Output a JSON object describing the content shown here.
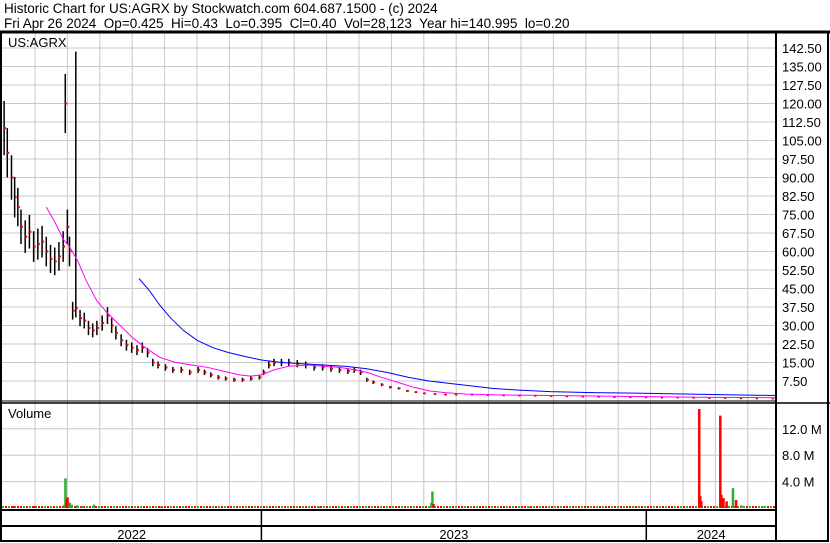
{
  "header": {
    "title": "Historic Chart for US:AGRX by Stockwatch.com 604.687.1500 - (c) 2024",
    "quote": "Fri Apr 26 2024  Op=0.425  Hi=0.43  Lo=0.395  Cl=0.40  Vol=28,123  Year hi=140.995  lo=0.20"
  },
  "colors": {
    "price_bar": "#000000",
    "close_tick": "#ff0000",
    "ma_short": "#ff00ff",
    "ma_long": "#0000ff",
    "vol_up": "#33aa33",
    "vol_down": "#ff0000",
    "grid": "#c8c8c8"
  },
  "chart_data": {
    "type": "line",
    "symbol": "US:AGRX",
    "x_unit": "days since start of chart",
    "x_range": [
      0,
      734
    ],
    "year_labels": [
      {
        "label": "2022",
        "start": 0,
        "end": 246
      },
      {
        "label": "2023",
        "start": 246,
        "end": 611
      },
      {
        "label": "2024",
        "start": 611,
        "end": 734
      }
    ],
    "price_axis": {
      "ticks": [
        "142.50",
        "135.00",
        "127.50",
        "120.00",
        "112.50",
        "105.00",
        "97.50",
        "90.00",
        "82.50",
        "75.00",
        "67.50",
        "60.00",
        "52.50",
        "45.00",
        "37.50",
        "30.00",
        "22.50",
        "15.00",
        "7.50"
      ],
      "range": [
        0,
        147
      ]
    },
    "price": [
      [
        2,
        110
      ],
      [
        5,
        100
      ],
      [
        9,
        90
      ],
      [
        12,
        82
      ],
      [
        15,
        78
      ],
      [
        18,
        70
      ],
      [
        22,
        66
      ],
      [
        26,
        68
      ],
      [
        30,
        62
      ],
      [
        34,
        63
      ],
      [
        38,
        64
      ],
      [
        42,
        60
      ],
      [
        46,
        57
      ],
      [
        50,
        56
      ],
      [
        54,
        58
      ],
      [
        58,
        62
      ],
      [
        60,
        120
      ],
      [
        62,
        70
      ],
      [
        64,
        60
      ],
      [
        67,
        36
      ],
      [
        70,
        37
      ],
      [
        74,
        33
      ],
      [
        78,
        32
      ],
      [
        82,
        29
      ],
      [
        86,
        28
      ],
      [
        90,
        29
      ],
      [
        95,
        31
      ],
      [
        100,
        34
      ],
      [
        104,
        30
      ],
      [
        108,
        27
      ],
      [
        113,
        24
      ],
      [
        118,
        22
      ],
      [
        123,
        21
      ],
      [
        128,
        20
      ],
      [
        133,
        21
      ],
      [
        138,
        19
      ],
      [
        143,
        15
      ],
      [
        148,
        14
      ],
      [
        155,
        13
      ],
      [
        162,
        12
      ],
      [
        170,
        12
      ],
      [
        178,
        11
      ],
      [
        186,
        12
      ],
      [
        192,
        11
      ],
      [
        198,
        10
      ],
      [
        205,
        9
      ],
      [
        212,
        8.5
      ],
      [
        220,
        8
      ],
      [
        228,
        8
      ],
      [
        236,
        8.5
      ],
      [
        244,
        9
      ],
      [
        248,
        11
      ],
      [
        253,
        14
      ],
      [
        258,
        15
      ],
      [
        265,
        15
      ],
      [
        272,
        15
      ],
      [
        280,
        14.5
      ],
      [
        288,
        14
      ],
      [
        296,
        13
      ],
      [
        304,
        13
      ],
      [
        312,
        12.5
      ],
      [
        320,
        12
      ],
      [
        328,
        11.5
      ],
      [
        334,
        12
      ],
      [
        340,
        11
      ],
      [
        346,
        8
      ],
      [
        352,
        7
      ],
      [
        360,
        6
      ],
      [
        368,
        5
      ],
      [
        376,
        4.5
      ],
      [
        384,
        3.5
      ],
      [
        392,
        3
      ],
      [
        400,
        2.5
      ],
      [
        410,
        2.2
      ],
      [
        420,
        2
      ],
      [
        430,
        2
      ],
      [
        445,
        2
      ],
      [
        460,
        1.8
      ],
      [
        475,
        1.7
      ],
      [
        490,
        1.6
      ],
      [
        505,
        1.5
      ],
      [
        520,
        1.4
      ],
      [
        535,
        1.3
      ],
      [
        550,
        1.2
      ],
      [
        565,
        1.1
      ],
      [
        580,
        1.0
      ],
      [
        595,
        1.0
      ],
      [
        610,
        0.9
      ],
      [
        625,
        0.8
      ],
      [
        640,
        0.8
      ],
      [
        655,
        0.7
      ],
      [
        670,
        0.6
      ],
      [
        685,
        0.6
      ],
      [
        700,
        0.5
      ],
      [
        715,
        0.45
      ],
      [
        730,
        0.4
      ]
    ],
    "ma_short": [
      [
        42,
        78
      ],
      [
        50,
        72
      ],
      [
        58,
        65
      ],
      [
        64,
        62
      ],
      [
        72,
        56
      ],
      [
        80,
        48
      ],
      [
        90,
        40
      ],
      [
        100,
        35
      ],
      [
        112,
        30
      ],
      [
        124,
        25
      ],
      [
        136,
        21
      ],
      [
        150,
        17
      ],
      [
        165,
        15
      ],
      [
        180,
        14
      ],
      [
        195,
        13
      ],
      [
        210,
        11.5
      ],
      [
        225,
        10
      ],
      [
        236,
        9.5
      ],
      [
        246,
        10
      ],
      [
        258,
        12
      ],
      [
        272,
        13.5
      ],
      [
        290,
        14
      ],
      [
        305,
        13.5
      ],
      [
        320,
        13
      ],
      [
        335,
        12
      ],
      [
        346,
        11
      ],
      [
        360,
        9
      ],
      [
        375,
        7
      ],
      [
        390,
        5
      ],
      [
        405,
        3.5
      ],
      [
        420,
        2.8
      ],
      [
        440,
        2.2
      ],
      [
        470,
        1.9
      ],
      [
        500,
        1.7
      ],
      [
        540,
        1.5
      ],
      [
        580,
        1.3
      ],
      [
        620,
        1.1
      ],
      [
        660,
        0.9
      ],
      [
        700,
        0.8
      ],
      [
        734,
        0.7
      ]
    ],
    "ma_long": [
      [
        130,
        49
      ],
      [
        140,
        44
      ],
      [
        150,
        38
      ],
      [
        160,
        33
      ],
      [
        172,
        28
      ],
      [
        185,
        24
      ],
      [
        200,
        21
      ],
      [
        215,
        19
      ],
      [
        230,
        17.5
      ],
      [
        246,
        16
      ],
      [
        265,
        15
      ],
      [
        285,
        14.5
      ],
      [
        305,
        14
      ],
      [
        325,
        13.5
      ],
      [
        345,
        12.5
      ],
      [
        365,
        11
      ],
      [
        385,
        9
      ],
      [
        405,
        7.5
      ],
      [
        425,
        6.5
      ],
      [
        445,
        5.5
      ],
      [
        465,
        4.5
      ],
      [
        490,
        3.8
      ],
      [
        520,
        3.2
      ],
      [
        560,
        2.8
      ],
      [
        600,
        2.6
      ],
      [
        640,
        2.3
      ],
      [
        680,
        2
      ],
      [
        734,
        1.6
      ]
    ],
    "volume_axis": {
      "ticks": [
        "12.0 M",
        "8.0 M",
        "4.0 M"
      ],
      "unit": "M",
      "range": [
        0,
        16
      ]
    },
    "volume": [
      [
        10,
        0.3,
        "d"
      ],
      [
        30,
        0.3,
        "d"
      ],
      [
        58,
        0.5,
        "u"
      ],
      [
        59,
        4.5,
        "u"
      ],
      [
        60,
        1.2,
        "d"
      ],
      [
        61,
        1.6,
        "d"
      ],
      [
        63,
        0.8,
        "u"
      ],
      [
        65,
        0.5,
        "u"
      ],
      [
        70,
        0.4,
        "u"
      ],
      [
        75,
        0.3,
        "u"
      ],
      [
        86,
        0.5,
        "u"
      ],
      [
        150,
        0.2,
        "d"
      ],
      [
        300,
        0.2,
        "d"
      ],
      [
        406,
        0.8,
        "u"
      ],
      [
        407,
        2.5,
        "u"
      ],
      [
        408,
        0.6,
        "d"
      ],
      [
        500,
        0.2,
        "d"
      ],
      [
        600,
        0.2,
        "d"
      ],
      [
        660,
        15.0,
        "d"
      ],
      [
        661,
        1.8,
        "d"
      ],
      [
        662,
        1.0,
        "d"
      ],
      [
        680,
        14.0,
        "d"
      ],
      [
        681,
        2.0,
        "d"
      ],
      [
        683,
        1.5,
        "d"
      ],
      [
        686,
        1.0,
        "d"
      ],
      [
        692,
        3.0,
        "u"
      ],
      [
        695,
        1.2,
        "d"
      ],
      [
        700,
        0.4,
        "u"
      ],
      [
        720,
        0.3,
        "u"
      ]
    ],
    "volume_label": "Volume"
  }
}
